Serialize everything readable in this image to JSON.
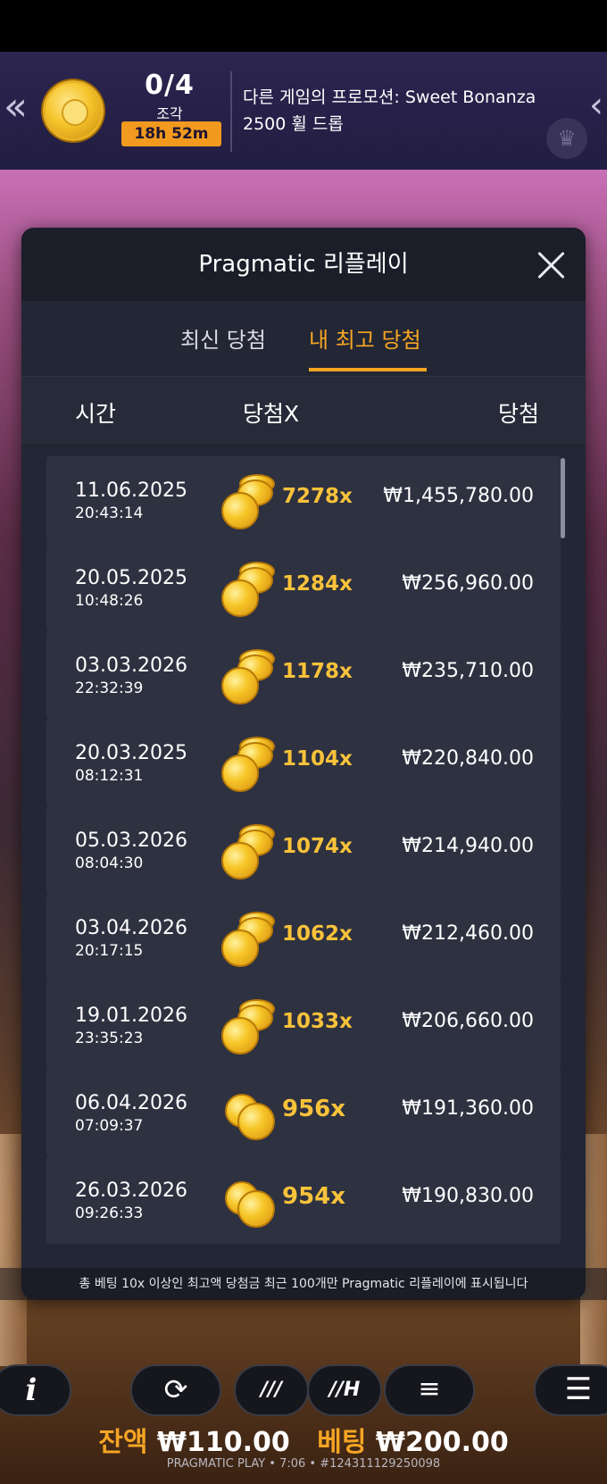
{
  "promo": {
    "count": "0/4",
    "unit": "조각",
    "timer": "18h 52m",
    "text": "다른 게임의 프로모션: Sweet Bonanza 2500 휠 드롭",
    "left_arrow": "«",
    "right_arrow": "‹"
  },
  "modal": {
    "title": "Pragmatic 리플레이",
    "tabs": [
      {
        "label": "최신 당첨",
        "active": false
      },
      {
        "label": "내 최고 당첨",
        "active": true
      }
    ],
    "columns": {
      "time": "시간",
      "multiplier": "당첨X",
      "win": "당첨"
    },
    "rows": [
      {
        "date": "11.06.2025",
        "time": "20:43:14",
        "mult": "7278x",
        "win": "₩1,455,780.00"
      },
      {
        "date": "20.05.2025",
        "time": "10:48:26",
        "mult": "1284x",
        "win": "₩256,960.00"
      },
      {
        "date": "03.03.2026",
        "time": "22:32:39",
        "mult": "1178x",
        "win": "₩235,710.00"
      },
      {
        "date": "20.03.2025",
        "time": "08:12:31",
        "mult": "1104x",
        "win": "₩220,840.00"
      },
      {
        "date": "05.03.2026",
        "time": "08:04:30",
        "mult": "1074x",
        "win": "₩214,940.00"
      },
      {
        "date": "03.04.2026",
        "time": "20:17:15",
        "mult": "1062x",
        "win": "₩212,460.00"
      },
      {
        "date": "19.01.2026",
        "time": "23:35:23",
        "mult": "1033x",
        "win": "₩206,660.00"
      },
      {
        "date": "06.04.2026",
        "time": "07:09:37",
        "mult": "956x",
        "win": "₩191,360.00"
      },
      {
        "date": "26.03.2026",
        "time": "09:26:33",
        "mult": "954x",
        "win": "₩190,830.00"
      }
    ]
  },
  "footnote": "총 베팅 10x 이상인 최고액 당첨금 최근 100개만 Pragmatic 리플레이에 표시됩니다",
  "controls": {
    "info": "i",
    "auto": "⟳",
    "turbo": "///",
    "hyper": "//H",
    "bet": "≡",
    "menu": "☰"
  },
  "balance": {
    "balance_label": "잔액",
    "balance_value": "₩110.00",
    "bet_label": "베팅",
    "bet_value": "₩200.00"
  },
  "footer": "PRAGMATIC PLAY • 7:06 • #124311129250098",
  "colors": {
    "accent": "#f6a623",
    "modal_bg": "#232634",
    "row_bg": "#2e3140"
  }
}
